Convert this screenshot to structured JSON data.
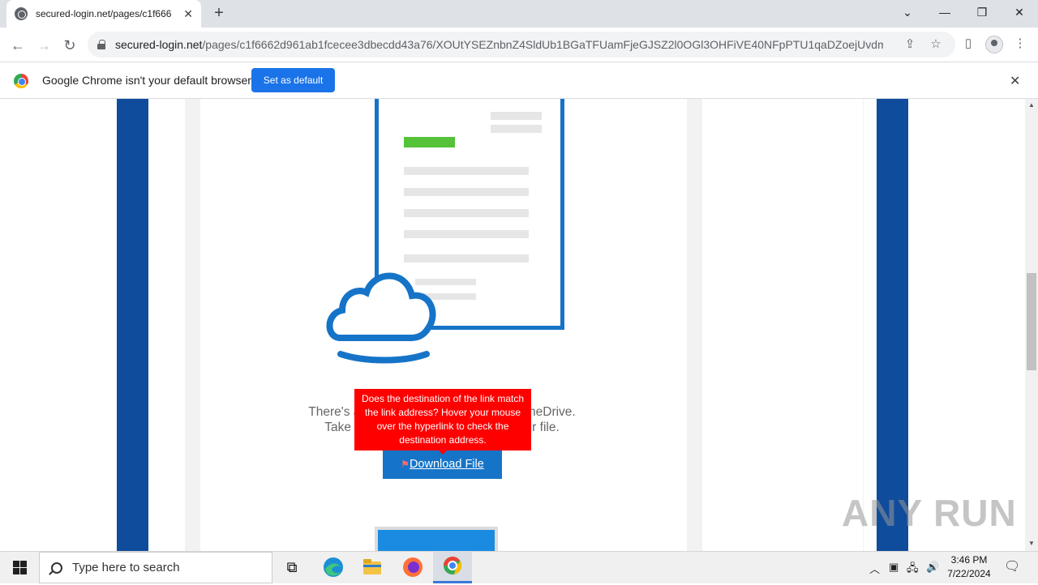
{
  "browser": {
    "tab_title": "secured-login.net/pages/c1f666",
    "new_tab_icon": "plus-icon",
    "url_host": "secured-login.net",
    "url_path": "/pages/c1f6662d961ab1fcecee3dbecdd43a76/XOUtYSEZnbnZ4SldUb1BGaTFUamFjeGJSZ2l0OGl3OHFiVE40NFpPTU1qaDZoejUvdmhsVW..."
  },
  "infobar": {
    "message": "Google Chrome isn't your default browser",
    "button": "Set as default"
  },
  "email": {
    "body_line1": "There's a new file shared with you on OneDrive.",
    "body_line2": "Take the next step and download your file.",
    "download_label": "Download File",
    "warning": "Does the destination of the link match the link address? Hover your mouse over the hyperlink to check the destination address.",
    "colors": {
      "band": "#0f4c9c",
      "accent": "#1674c8",
      "status_bar": "#55c23a",
      "warning": "#ff0000"
    }
  },
  "watermark": "ANY RUN",
  "taskbar": {
    "search_placeholder": "Type here to search",
    "time": "3:46 PM",
    "date": "7/22/2024"
  }
}
